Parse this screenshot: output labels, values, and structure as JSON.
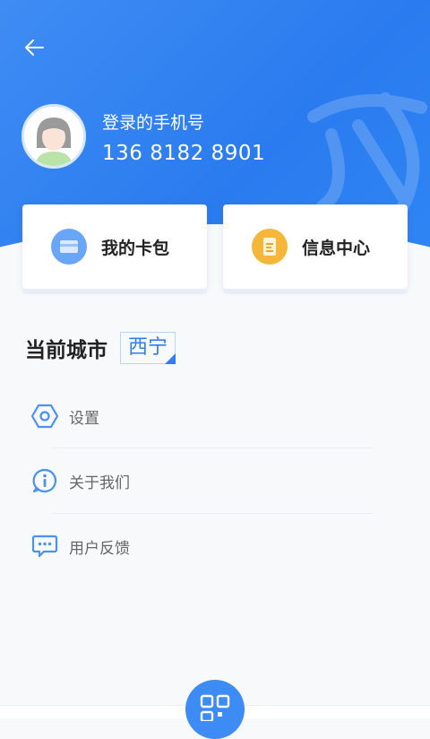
{
  "header": {
    "back_icon": "arrow-left-icon",
    "user_label": "登录的手机号",
    "phone": "136 8182 8901",
    "avatar_icon": "user-avatar-icon"
  },
  "cards": [
    {
      "label": "我的卡包",
      "icon": "wallet-card-icon",
      "color": "#5b9cf6"
    },
    {
      "label": "信息中心",
      "icon": "document-icon",
      "color": "#f4b234"
    }
  ],
  "city": {
    "title": "当前城市",
    "value": "西宁"
  },
  "menu": [
    {
      "label": "设置",
      "icon": "settings-hexagon-icon"
    },
    {
      "label": "关于我们",
      "icon": "info-icon"
    },
    {
      "label": "用户反馈",
      "icon": "feedback-chat-icon"
    }
  ],
  "bottom": {
    "qr_icon": "qr-code-icon"
  },
  "colors": {
    "primary": "#2f7ef3",
    "header": "#3f8cf4",
    "text": "#222222",
    "muted": "#666666"
  }
}
